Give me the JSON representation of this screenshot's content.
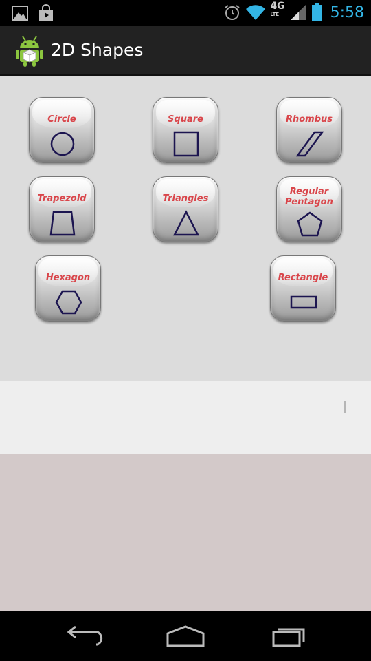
{
  "status_bar": {
    "time": "5:58",
    "network": "4G",
    "network_sub": "LTE",
    "icons": [
      "gallery-icon",
      "store-icon",
      "alarm-icon",
      "wifi-icon",
      "signal-icon",
      "battery-icon"
    ]
  },
  "action_bar": {
    "title": "2D Shapes",
    "icon": "android-cube-icon"
  },
  "shapes": [
    {
      "label": "Circle",
      "icon": "circle-icon"
    },
    {
      "label": "Square",
      "icon": "square-icon"
    },
    {
      "label": "Rhombus",
      "icon": "rhombus-icon"
    },
    {
      "label": "Trapezoid",
      "icon": "trapezoid-icon"
    },
    {
      "label": "Triangles",
      "icon": "triangle-icon"
    },
    {
      "label_line1": "Regular",
      "label_line2": "Pentagon",
      "icon": "pentagon-icon"
    },
    {
      "label": "Hexagon",
      "icon": "hexagon-icon"
    },
    {
      "label": "Rectangle",
      "icon": "rectangle-icon"
    }
  ],
  "nav_bar": {
    "buttons": [
      "back-icon",
      "home-icon",
      "recents-icon"
    ]
  },
  "colors": {
    "label": "#d9454a",
    "shape_stroke": "#1c1550",
    "accent": "#33b5e5"
  }
}
